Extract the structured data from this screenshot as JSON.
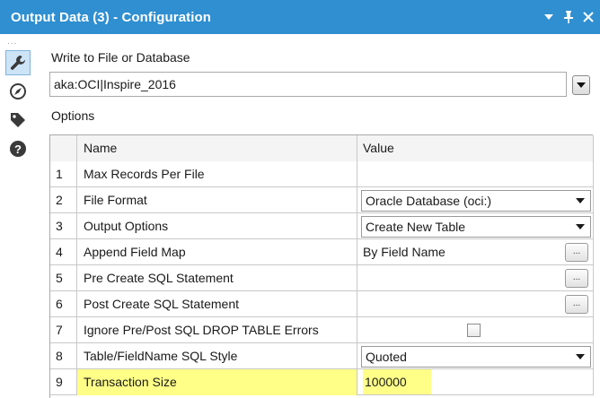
{
  "window": {
    "title": "Output Data (3) - Configuration",
    "controls": {
      "menu": "dropdown-arrow-icon",
      "pin": "pin-icon",
      "close": "close-icon"
    }
  },
  "sidebar": {
    "grip": "...",
    "items": [
      {
        "icon": "wrench-icon",
        "active": true
      },
      {
        "icon": "navigate-icon",
        "active": false
      },
      {
        "icon": "tag-icon",
        "active": false
      },
      {
        "icon": "help-icon",
        "active": false
      }
    ]
  },
  "write_target": {
    "label": "Write to File or Database",
    "value": "aka:OCI|Inspire_2016"
  },
  "options": {
    "label": "Options",
    "columns": [
      "Name",
      "Value"
    ],
    "rows": [
      {
        "num": "1",
        "name": "Max Records Per File",
        "value": "",
        "control": "text"
      },
      {
        "num": "2",
        "name": "File Format",
        "value": "Oracle Database (oci:)",
        "control": "combo"
      },
      {
        "num": "3",
        "name": "Output Options",
        "value": "Create New Table",
        "control": "combo"
      },
      {
        "num": "4",
        "name": "Append Field Map",
        "value": "By Field Name",
        "control": "ellipsis",
        "button": "..."
      },
      {
        "num": "5",
        "name": "Pre Create SQL Statement",
        "value": "",
        "control": "ellipsis",
        "button": "..."
      },
      {
        "num": "6",
        "name": "Post Create SQL Statement",
        "value": "",
        "control": "ellipsis",
        "button": "..."
      },
      {
        "num": "7",
        "name": "Ignore Pre/Post SQL DROP TABLE Errors",
        "value": "",
        "control": "checkbox",
        "checked": false
      },
      {
        "num": "8",
        "name": "Table/FieldName SQL Style",
        "value": "Quoted",
        "control": "combo"
      },
      {
        "num": "9",
        "name": "Transaction Size",
        "value": "100000",
        "control": "text",
        "highlighted": true
      }
    ]
  },
  "colors": {
    "titlebar": "#2f8fd0",
    "highlight": "#ffff88",
    "icon": "#3a3a3a"
  }
}
